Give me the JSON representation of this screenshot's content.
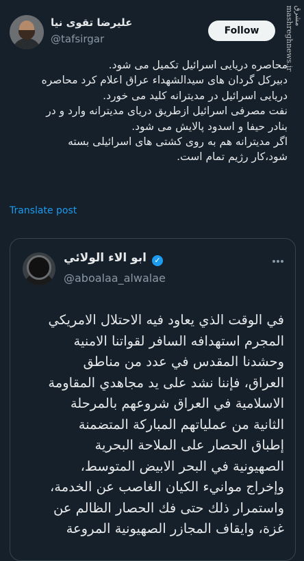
{
  "tweet": {
    "author_name": "علیرضا تقوی نیا",
    "author_handle": "@tafsirgar",
    "follow_label": "Follow",
    "text_lines": [
      "محاصره دریایی اسرائیل تکمیل می شود.",
      "دبیرکل گردان های سیدالشهداء عراق اعلام کرد محاصره",
      "دریایی اسرائیل در مدیترانه کلید می خورد.",
      "نفت مصرفی اسرائیل ازطریق دریای مدیترانه وارد و در",
      "بنادر حیفا و اسدود پالایش می شود.",
      "اگر مدیترانه هم به روی کشتی های اسرائیلی بسته",
      "شود،کار رژیم تمام است."
    ],
    "translate_label": "Translate post"
  },
  "watermark": "مشرق mashreghnews.ir",
  "quoted": {
    "author_name": "ابو الاء الولائي",
    "author_handle": "@aboalaa_alwalae",
    "verified_glyph": "✓",
    "text_lines": [
      "في الوقت الذي يعاود فيه الاحتلال الامريكي",
      "المجرم استهدافه السافر لقواتنا الامنية",
      "وحشدنا المقدس في عدد من مناطق",
      "العراق، فإننا نشد على يد مجاهدي المقاومة",
      "الاسلامية في العراق شروعهم بالمرحلة",
      "الثانية من عملياتهم المباركة المتضمنة",
      "إطباق الحصار على الملاحة البحرية",
      "الصهيونية في البحر الابيض المتوسط،",
      "وإخراج موانيء الكيان الغاصب عن الخدمة،",
      "واستمرار ذلك حتى فك الحصار الظالم عن",
      "غزة، وايقاف المجازر الصهيونية المروعة"
    ]
  },
  "icons": {
    "more": "more-horizontal-icon",
    "verified": "verified-badge-icon"
  },
  "colors": {
    "background": "#15202b",
    "accent": "#1d9bf0",
    "secondary_text": "#8b98a5",
    "border": "#38444d"
  }
}
